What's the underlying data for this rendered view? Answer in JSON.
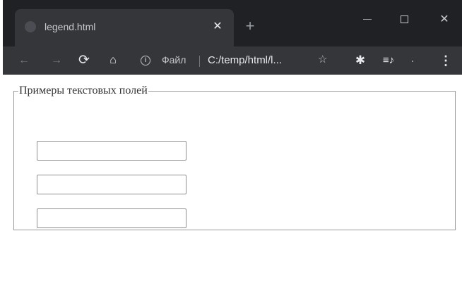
{
  "browser": {
    "tab": {
      "title": "legend.html",
      "close_icon": "close-icon"
    },
    "new_tab_glyph": "+",
    "toolbar": {
      "back_glyph": "←",
      "forward_glyph": "→",
      "reload_glyph": "⟳",
      "home_glyph": "⌂",
      "scheme_label": "Файл",
      "url": "C:/temp/html/l...",
      "star_glyph": "☆",
      "extensions_glyph": "✱",
      "media_glyph": "≡♪",
      "profile_glyph": "·",
      "menu_glyph": "⋮"
    },
    "window_controls": {
      "close_glyph": "✕"
    }
  },
  "page": {
    "fieldset": {
      "legend": "Примеры текстовых полей",
      "fields": [
        {
          "value": ""
        },
        {
          "value": ""
        },
        {
          "value": ""
        }
      ]
    }
  }
}
